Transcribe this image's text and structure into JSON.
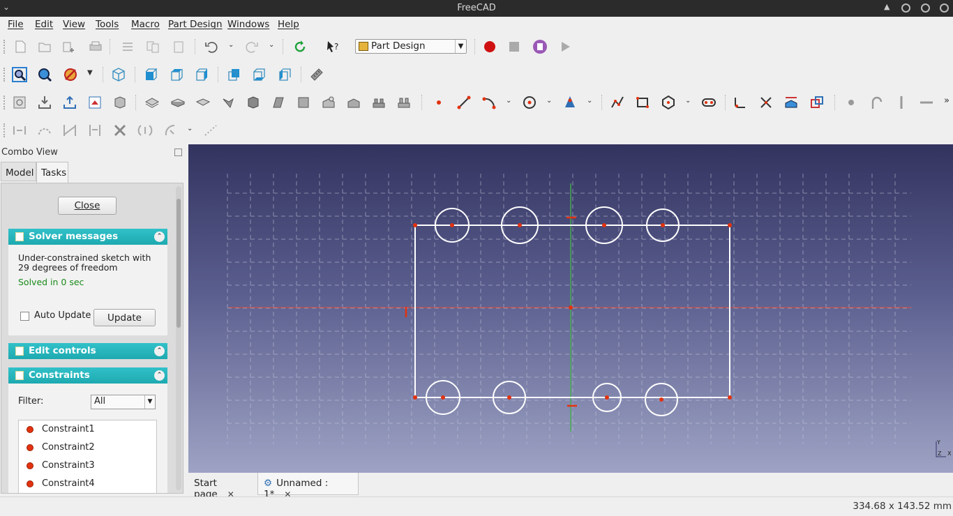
{
  "window": {
    "title": "FreeCAD"
  },
  "menu": [
    "File",
    "Edit",
    "View",
    "Tools",
    "Macro",
    "Part Design",
    "Windows",
    "Help"
  ],
  "workbench": {
    "selected": "Part Design"
  },
  "combo_view": {
    "title": "Combo View",
    "tabs": [
      "Model",
      "Tasks"
    ],
    "active_tab": "Tasks",
    "close_label": "Close",
    "solver": {
      "title": "Solver messages",
      "message": "Under-constrained sketch with 29 degrees of freedom",
      "solved": "Solved in 0 sec",
      "auto_update_label": "Auto Update",
      "update_label": "Update"
    },
    "edit_controls": {
      "title": "Edit controls"
    },
    "constraints": {
      "title": "Constraints",
      "filter_label": "Filter:",
      "filter_value": "All",
      "items": [
        "Constraint1",
        "Constraint2",
        "Constraint3",
        "Constraint4"
      ]
    }
  },
  "doc_tabs": [
    {
      "label": "Start page"
    },
    {
      "label": "Unnamed : 1*"
    }
  ],
  "status": {
    "dimensions": "334.68 x 143.52 mm"
  },
  "axis_labels": {
    "y": "Y",
    "z": "Z",
    "x": "X"
  },
  "colors": {
    "accent": "#25b4bb",
    "sketch": "#ffffff",
    "point": "#e2320f",
    "axis_h": "#c0392b",
    "axis_v": "#4caf50"
  }
}
